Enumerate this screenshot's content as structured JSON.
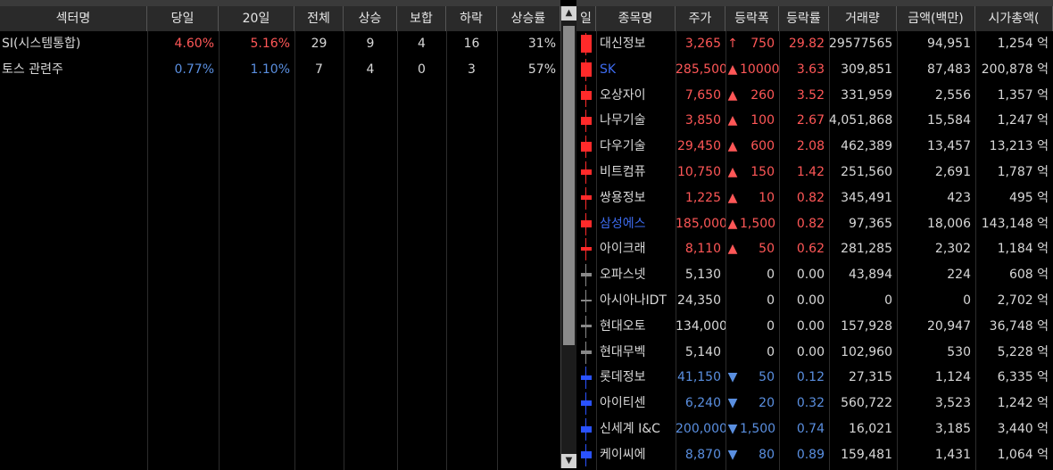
{
  "left_table": {
    "headers": [
      "섹터명",
      "당일",
      "20일",
      "전체",
      "상승",
      "보합",
      "하락",
      "상승률"
    ],
    "rows": [
      {
        "name": "SI(시스템통합)",
        "today": "4.60%",
        "d20": "5.16%",
        "total": "29",
        "up": "9",
        "flat": "4",
        "down": "16",
        "up_rate": "31%",
        "dir": "up"
      },
      {
        "name": "토스 관련주",
        "today": "0.77%",
        "d20": "1.10%",
        "total": "7",
        "up": "4",
        "flat": "0",
        "down": "3",
        "up_rate": "57%",
        "dir": "dn"
      }
    ]
  },
  "right_table": {
    "headers": [
      "일",
      "종목명",
      "주가",
      "등락폭",
      "등락률",
      "거래량",
      "금액(백만)",
      "시가총액("
    ],
    "rows": [
      {
        "name": "대신정보",
        "price": "3,265",
        "sym": "↑",
        "change": "750",
        "rate": "29.82",
        "volume": "29577565",
        "amount": "94,951",
        "cap": "1,254 억",
        "dir": "up",
        "bar": 1.0
      },
      {
        "name": "SK",
        "price": "285,500",
        "sym": "▲",
        "change": "10000",
        "rate": "3.63",
        "volume": "309,851",
        "amount": "87,483",
        "cap": "200,878 억",
        "dir": "up",
        "name_color": "#3d6cf0",
        "bar": 0.8
      },
      {
        "name": "오상자이",
        "price": "7,650",
        "sym": "▲",
        "change": "260",
        "rate": "3.52",
        "volume": "331,959",
        "amount": "2,556",
        "cap": "1,357 억",
        "dir": "up",
        "bar": 0.5
      },
      {
        "name": "나무기술",
        "price": "3,850",
        "sym": "▲",
        "change": "100",
        "rate": "2.67",
        "volume": "4,051,868",
        "amount": "15,584",
        "cap": "1,247 억",
        "dir": "up",
        "bar": 0.45
      },
      {
        "name": "다우기술",
        "price": "29,450",
        "sym": "▲",
        "change": "600",
        "rate": "2.08",
        "volume": "462,389",
        "amount": "13,457",
        "cap": "13,213 억",
        "dir": "up",
        "bar": 0.55
      },
      {
        "name": "비트컴퓨",
        "price": "10,750",
        "sym": "▲",
        "change": "150",
        "rate": "1.42",
        "volume": "251,560",
        "amount": "2,691",
        "cap": "1,787 억",
        "dir": "up",
        "bar": 0.3
      },
      {
        "name": "쌍용정보",
        "price": "1,225",
        "sym": "▲",
        "change": "10",
        "rate": "0.82",
        "volume": "345,491",
        "amount": "423",
        "cap": "495 억",
        "dir": "up",
        "bar": 0.25
      },
      {
        "name": "삼성에스",
        "price": "185,000",
        "sym": "▲",
        "change": "1,500",
        "rate": "0.82",
        "volume": "97,365",
        "amount": "18,006",
        "cap": "143,148 억",
        "dir": "up",
        "name_color": "#3d6cf0",
        "bar": 0.4
      },
      {
        "name": "아이크래",
        "price": "8,110",
        "sym": "▲",
        "change": "50",
        "rate": "0.62",
        "volume": "281,285",
        "amount": "2,302",
        "cap": "1,184 억",
        "dir": "up",
        "bar": 0.2
      },
      {
        "name": "오파스넷",
        "price": "5,130",
        "sym": "",
        "change": "0",
        "rate": "0.00",
        "volume": "43,894",
        "amount": "224",
        "cap": "608 억",
        "dir": "neu",
        "bar": 0.2
      },
      {
        "name": "아시아나IDT",
        "price": "24,350",
        "sym": "",
        "change": "0",
        "rate": "0.00",
        "volume": "0",
        "amount": "0",
        "cap": "2,702 억",
        "dir": "neu",
        "bar": 0.1
      },
      {
        "name": "현대오토",
        "price": "134,000",
        "sym": "",
        "change": "0",
        "rate": "0.00",
        "volume": "157,928",
        "amount": "20,947",
        "cap": "36,748 억",
        "dir": "neu",
        "bar": 0.15
      },
      {
        "name": "현대무벡",
        "price": "5,140",
        "sym": "",
        "change": "0",
        "rate": "0.00",
        "volume": "102,960",
        "amount": "530",
        "cap": "5,228 억",
        "dir": "neu",
        "bar": 0.2
      },
      {
        "name": "롯데정보",
        "price": "41,150",
        "sym": "▼",
        "change": "50",
        "rate": "0.12",
        "volume": "27,315",
        "amount": "1,124",
        "cap": "6,335 억",
        "dir": "dn",
        "bar": 0.25
      },
      {
        "name": "아이티센",
        "price": "6,240",
        "sym": "▼",
        "change": "20",
        "rate": "0.32",
        "volume": "560,722",
        "amount": "3,523",
        "cap": "1,242 억",
        "dir": "dn",
        "bar": 0.3
      },
      {
        "name": "신세계 I&C",
        "price": "200,000",
        "sym": "▼",
        "change": "1,500",
        "rate": "0.74",
        "volume": "16,021",
        "amount": "3,185",
        "cap": "3,440 억",
        "dir": "dn",
        "bar": 0.35
      },
      {
        "name": "케이씨에",
        "price": "8,870",
        "sym": "▼",
        "change": "80",
        "rate": "0.89",
        "volume": "159,481",
        "amount": "1,431",
        "cap": "1,064 억",
        "dir": "dn",
        "bar": 0.4
      }
    ]
  },
  "scrollbar": {
    "up_arrow": "▲",
    "down_arrow": "▼"
  },
  "colors": {
    "up": "#ff5757",
    "down": "#5a8fe0",
    "header_bg": "#2a2a2a",
    "bar_up": "#ff2a2a",
    "bar_down": "#2a52ff"
  }
}
